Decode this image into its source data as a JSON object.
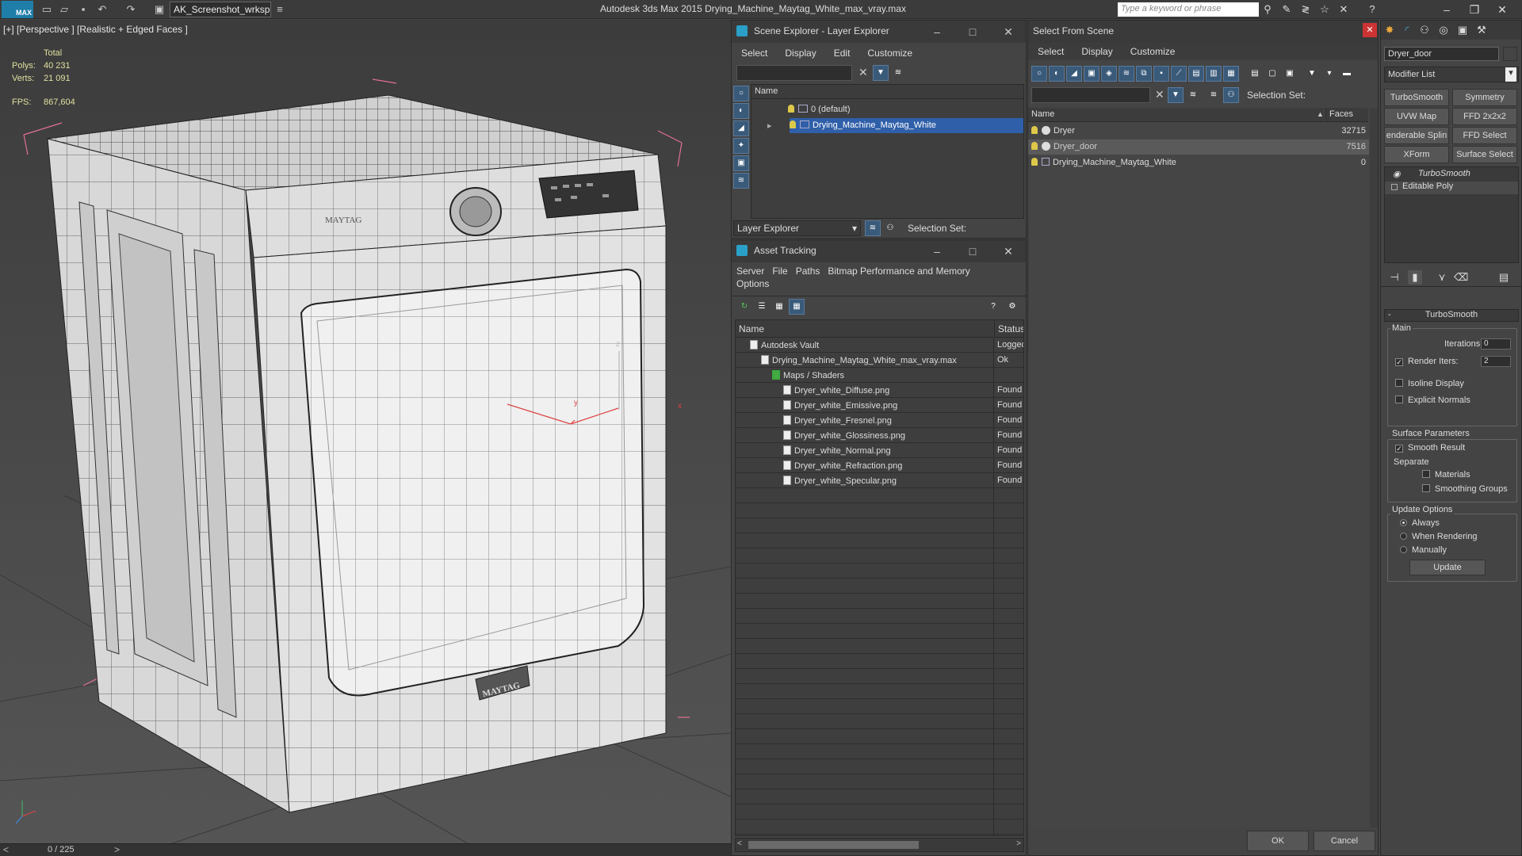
{
  "app": {
    "title": "Autodesk 3ds Max  2015    Drying_Machine_Maytag_White_max_vray.max",
    "logo": "MAX",
    "workspace": "AK_Screenshot_wrksp",
    "search_placeholder": "Type a keyword or phrase"
  },
  "viewport": {
    "label": "[+] [Perspective ] [Realistic + Edged Faces ]",
    "stats": {
      "total_label": "Total",
      "polys_label": "Polys:",
      "polys": "40 231",
      "verts_label": "Verts:",
      "verts": "21 091",
      "fps_label": "FPS:",
      "fps": "867,604"
    },
    "timeline": "0 / 225",
    "brand_badge": "MAYTAG",
    "panel_logo": "MAYTAG",
    "axis_y": "y",
    "axis_x": "x",
    "axis_z": "z"
  },
  "scene_explorer": {
    "title": "Scene Explorer - Layer Explorer",
    "menu": [
      "Select",
      "Display",
      "Edit",
      "Customize"
    ],
    "column": "Name",
    "rows": [
      {
        "label": "0 (default)",
        "selected": false
      },
      {
        "label": "Drying_Machine_Maytag_White",
        "selected": true
      }
    ],
    "footer_dropdown": "Layer Explorer",
    "selection_set": "Selection Set:"
  },
  "asset_tracking": {
    "title": "Asset Tracking",
    "menu": [
      "Server",
      "File",
      "Paths",
      "Bitmap Performance and Memory"
    ],
    "menu2": "Options",
    "columns": [
      "Name",
      "Status"
    ],
    "rows": [
      {
        "name": "Autodesk Vault",
        "status": "Logged",
        "indent": 0
      },
      {
        "name": "Drying_Machine_Maytag_White_max_vray.max",
        "status": "Ok",
        "indent": 1
      },
      {
        "name": "Maps / Shaders",
        "status": "",
        "indent": 2
      },
      {
        "name": "Dryer_white_Diffuse.png",
        "status": "Found",
        "indent": 3
      },
      {
        "name": "Dryer_white_Emissive.png",
        "status": "Found",
        "indent": 3
      },
      {
        "name": "Dryer_white_Fresnel.png",
        "status": "Found",
        "indent": 3
      },
      {
        "name": "Dryer_white_Glossiness.png",
        "status": "Found",
        "indent": 3
      },
      {
        "name": "Dryer_white_Normal.png",
        "status": "Found",
        "indent": 3
      },
      {
        "name": "Dryer_white_Refraction.png",
        "status": "Found",
        "indent": 3
      },
      {
        "name": "Dryer_white_Specular.png",
        "status": "Found",
        "indent": 3
      }
    ]
  },
  "select_from_scene": {
    "title": "Select From Scene",
    "menu": [
      "Select",
      "Display",
      "Customize"
    ],
    "selection_set": "Selection Set:",
    "columns": [
      "Name",
      "Faces"
    ],
    "rows": [
      {
        "name": "Dryer",
        "faces": "32715",
        "highlight": false
      },
      {
        "name": "Dryer_door",
        "faces": "7516",
        "highlight": true
      },
      {
        "name": "Drying_Machine_Maytag_White",
        "faces": "0",
        "highlight": false
      }
    ],
    "ok": "OK",
    "cancel": "Cancel"
  },
  "command_panel": {
    "object_name": "Dryer_door",
    "modifier_list": "Modifier List",
    "mod_buttons": [
      "TurboSmooth",
      "Symmetry",
      "UVW Map",
      "FFD 2x2x2",
      "enderable Splin",
      "FFD Select",
      "XForm",
      "Surface Select"
    ],
    "stack": [
      "TurboSmooth",
      "Editable Poly"
    ],
    "rollout_title": "TurboSmooth",
    "main_label": "Main",
    "iterations_label": "Iterations:",
    "iterations": "0",
    "render_iters_label": "Render Iters:",
    "render_iters": "2",
    "isoline": "Isoline Display",
    "explicit_normals": "Explicit Normals",
    "surface_params": "Surface Parameters",
    "smooth_result": "Smooth Result",
    "separate": "Separate",
    "materials": "Materials",
    "smoothing_groups": "Smoothing Groups",
    "update_options": "Update Options",
    "always": "Always",
    "when_rendering": "When Rendering",
    "manually": "Manually",
    "update_btn": "Update"
  }
}
